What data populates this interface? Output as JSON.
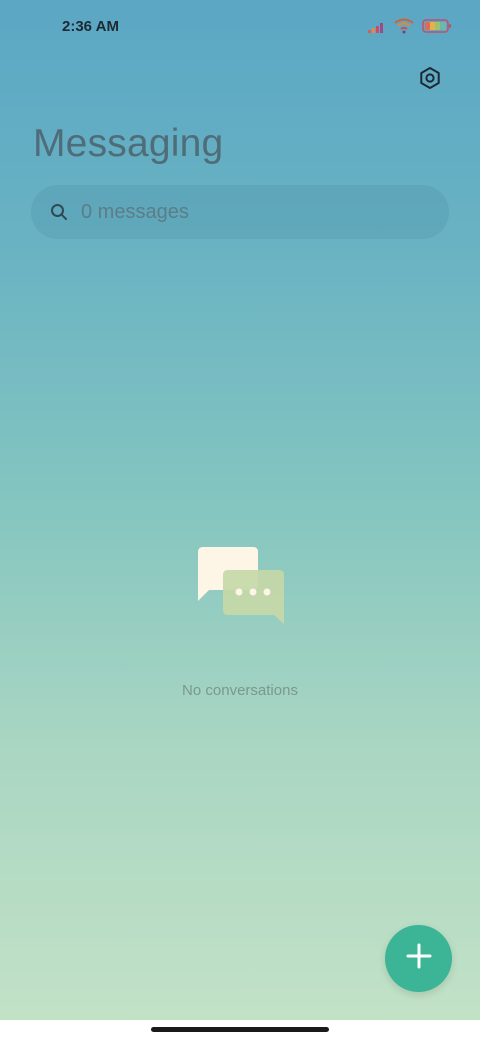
{
  "status_bar": {
    "time": "2:36 AM",
    "icons": [
      "signal-icon",
      "wifi-icon",
      "battery-icon"
    ]
  },
  "header": {
    "title": "Messaging",
    "settings_icon": "settings-hexagon-icon"
  },
  "search": {
    "placeholder": "0 messages",
    "icon": "search-icon"
  },
  "empty_state": {
    "icon": "conversations-icon",
    "text": "No conversations"
  },
  "fab": {
    "icon": "plus-icon",
    "color": "#3cb496"
  },
  "colors": {
    "gradient_top": "#5ba7c4",
    "gradient_bottom": "#c2e2c6",
    "accent": "#3cb496"
  }
}
